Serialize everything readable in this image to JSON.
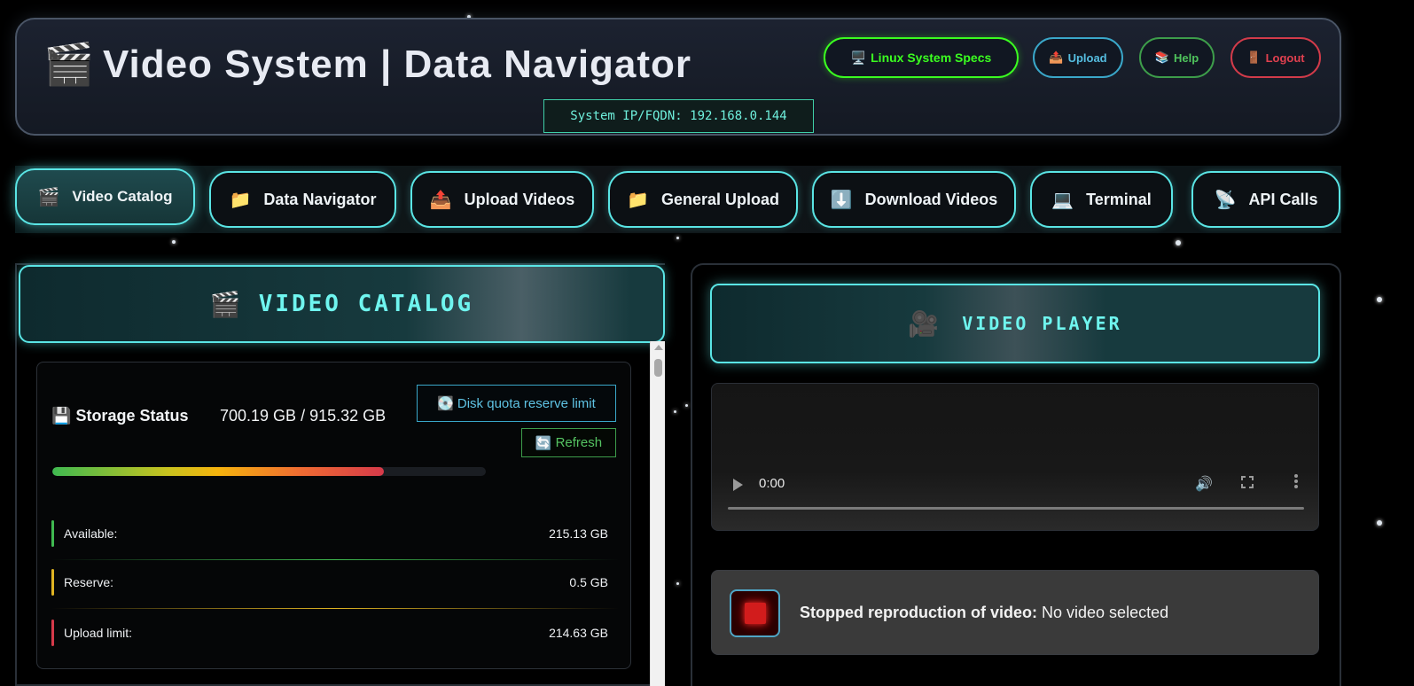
{
  "header": {
    "logo_icon": "clapperboard-icon",
    "logo_glyph": "🎬",
    "title": "Video System | Data Navigator",
    "system_ip": "System IP/FQDN: 192.168.0.144",
    "buttons": {
      "specs": {
        "icon": "🖥️",
        "label": "Linux System Specs"
      },
      "upload": {
        "icon": "📤",
        "label": "Upload"
      },
      "help": {
        "icon": "📚",
        "label": "Help"
      },
      "logout": {
        "icon": "🚪",
        "label": "Logout"
      }
    }
  },
  "nav": {
    "tabs": [
      {
        "icon": "🎬",
        "label": "Video Catalog"
      },
      {
        "icon": "📁",
        "label": "Data Navigator"
      },
      {
        "icon": "📤",
        "label": "Upload Videos"
      },
      {
        "icon": "📁",
        "label": "General Upload"
      },
      {
        "icon": "⬇️",
        "label": "Download Videos"
      },
      {
        "icon": "💻",
        "label": "Terminal"
      },
      {
        "icon": "📡",
        "label": "API Calls"
      }
    ],
    "active_tab": "Video Catalog"
  },
  "catalog": {
    "icon": "🎬",
    "title": "VIDEO CATALOG",
    "storage": {
      "icon": "💾",
      "label": "Storage Status",
      "value": "700.19 GB / 915.32 GB",
      "usage_fraction": 0.765,
      "quota_button": {
        "icon": "💽",
        "label": "Disk quota reserve limit"
      },
      "refresh_button": {
        "icon": "🔄",
        "label": "Refresh"
      },
      "stats": [
        {
          "label": "Available:",
          "value": "215.13 GB",
          "color": "#3fb950"
        },
        {
          "label": "Reserve:",
          "value": "0.5 GB",
          "color": "#e0b422"
        },
        {
          "label": "Upload limit:",
          "value": "214.63 GB",
          "color": "#d63a4a"
        }
      ]
    }
  },
  "player": {
    "icon": "🎥",
    "title": "VIDEO PLAYER",
    "time": "0:00",
    "status": {
      "prefix": "Stopped reproduction of video:",
      "value": "No video selected"
    }
  },
  "colors": {
    "accent": "#5ae5e5",
    "specs_green": "#3bff20",
    "upload_blue": "#3aa7c9",
    "help_green": "#3d9d4a",
    "logout_red": "#d23b4a"
  }
}
